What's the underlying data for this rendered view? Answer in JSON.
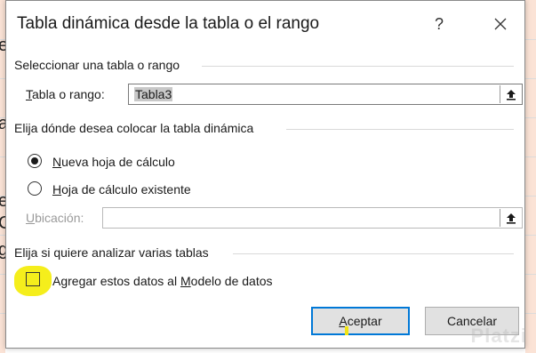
{
  "dialog": {
    "title": "Tabla dinámica desde la tabla o el rango",
    "help_label": "?",
    "select_section": {
      "title": "Seleccionar una tabla o rango",
      "range_label_accesskey": "T",
      "range_label_rest": "abla o rango:",
      "range_value": "Tabla3"
    },
    "placement_section": {
      "title": "Elija dónde desea colocar la tabla dinámica",
      "options": [
        {
          "accesskey": "N",
          "rest": "ueva hoja de cálculo",
          "selected": true
        },
        {
          "accesskey": "H",
          "rest": "oja de cálculo existente",
          "selected": false
        }
      ],
      "location_label_accesskey": "U",
      "location_label_rest": "bicación:",
      "location_value": ""
    },
    "analyze_section": {
      "title": "Elija si quiere analizar varias tablas",
      "checkbox_prefix": "Agregar estos datos al ",
      "checkbox_accesskey": "M",
      "checkbox_suffix": "odelo de datos",
      "checked": false
    },
    "buttons": {
      "ok_accesskey": "A",
      "ok_rest": "ceptar",
      "cancel": "Cancelar"
    }
  },
  "background": {
    "fragments": [
      "e",
      "a",
      "t",
      "e",
      "C",
      "g"
    ]
  },
  "watermark": "Platzi",
  "colors": {
    "highlight": "#f5ee1c",
    "accent": "#0078d7",
    "button_bg": "#e1e1e1",
    "cell_fill": "#fbe3d6"
  }
}
